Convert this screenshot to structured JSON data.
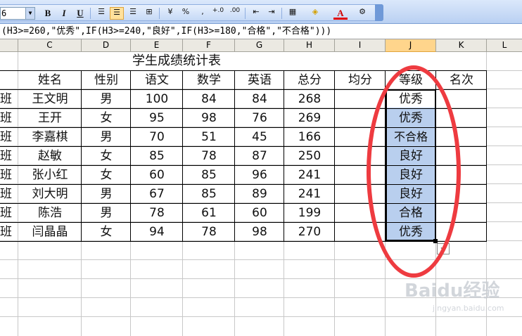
{
  "toolbar": {
    "font_size": "6",
    "bold": "B",
    "italic": "I",
    "underline": "U",
    "percent": "%",
    "comma": ",",
    "inc_decimal": "+.0",
    "dec_decimal": ".00",
    "font_color_letter": "A"
  },
  "formula_bar": {
    "text": "(H3>=260,\"优秀\",IF(H3>=240,\"良好\",IF(H3>=180,\"合格\",\"不合格\")))"
  },
  "columns": [
    "C",
    "D",
    "E",
    "F",
    "G",
    "H",
    "I",
    "J",
    "K",
    "L"
  ],
  "selected_column": "J",
  "sheet": {
    "title": "学生成绩统计表",
    "headers": [
      "姓名",
      "性别",
      "语文",
      "数学",
      "英语",
      "总分",
      "均分",
      "等级",
      "名次"
    ],
    "row_prefix": "班",
    "rows": [
      {
        "name": "王文明",
        "gender": "男",
        "chinese": "100",
        "math": "84",
        "english": "84",
        "total": "268",
        "grade": "优秀"
      },
      {
        "name": "王开",
        "gender": "女",
        "chinese": "95",
        "math": "98",
        "english": "76",
        "total": "269",
        "grade": "优秀"
      },
      {
        "name": "李嘉棋",
        "gender": "男",
        "chinese": "70",
        "math": "51",
        "english": "45",
        "total": "166",
        "grade": "不合格"
      },
      {
        "name": "赵敏",
        "gender": "女",
        "chinese": "85",
        "math": "78",
        "english": "87",
        "total": "250",
        "grade": "良好"
      },
      {
        "name": "张小红",
        "gender": "女",
        "chinese": "60",
        "math": "85",
        "english": "96",
        "total": "241",
        "grade": "良好"
      },
      {
        "name": "刘大明",
        "gender": "男",
        "chinese": "67",
        "math": "85",
        "english": "89",
        "total": "241",
        "grade": "良好"
      },
      {
        "name": "陈浩",
        "gender": "男",
        "chinese": "78",
        "math": "61",
        "english": "60",
        "total": "199",
        "grade": "合格"
      },
      {
        "name": "闫晶晶",
        "gender": "女",
        "chinese": "94",
        "math": "78",
        "english": "98",
        "total": "270",
        "grade": "优秀"
      }
    ]
  },
  "autofill_symbol": "+",
  "watermark": {
    "logo": "Baidu经验",
    "url": "jingyan.baidu.com"
  },
  "colors": {
    "annotation_ellipse": "#ee3b40",
    "selection": "#b9cfee",
    "selected_header": "#ffd58c"
  }
}
